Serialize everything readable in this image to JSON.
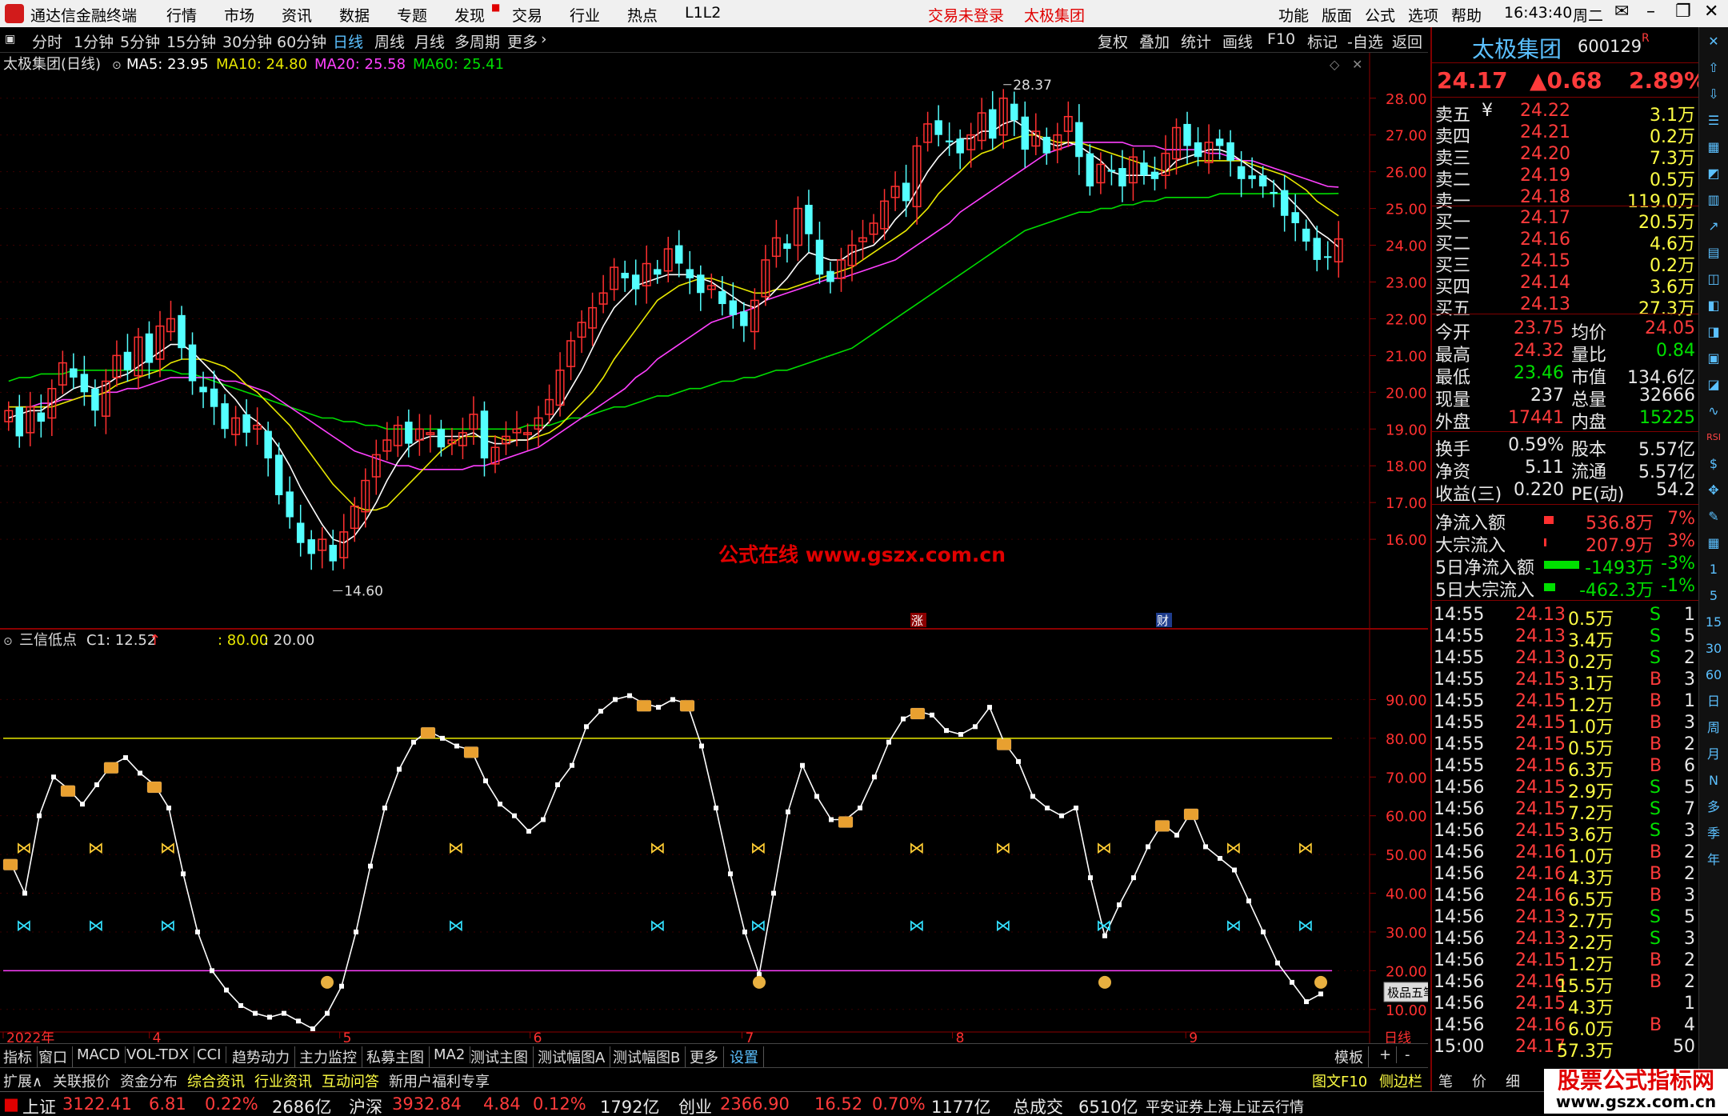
{
  "window": {
    "app_title": "通达信金融终端",
    "menu": [
      "行情",
      "市场",
      "资讯",
      "数据",
      "专题",
      "发现",
      "交易",
      "行业",
      "热点",
      "L1L2"
    ],
    "login_status": "交易未登录",
    "stock_name_title": "太极集团",
    "right_menu": [
      "功能",
      "版面",
      "公式",
      "选项",
      "帮助"
    ],
    "time": "16:43:40",
    "weekday": "周二"
  },
  "toolbar": {
    "periods": [
      "分时",
      "1分钟",
      "5分钟",
      "15分钟",
      "30分钟",
      "60分钟",
      "日线",
      "周线",
      "月线",
      "多周期",
      "更多"
    ],
    "active_period": "日线",
    "actions": [
      "复权",
      "叠加",
      "统计",
      "画线",
      "F10",
      "标记",
      "-自选",
      "返回"
    ]
  },
  "main_chart": {
    "label": "太极集团(日线)",
    "ma5": "MA5: 23.95",
    "ma10": "MA10: 24.80",
    "ma20": "MA20: 25.58",
    "ma60": "MA60: 25.41",
    "high_label": "28.37",
    "low_label": "14.60",
    "watermark": "公式在线   www.gszx.com.cn",
    "marker_zhang": "涨",
    "marker_cai": "财",
    "colors": {
      "up": "#ff3030",
      "down": "#54ffff",
      "ma5": "#ffffff",
      "ma10": "#e8e800",
      "ma20": "#ff40ff",
      "ma60": "#00dd00"
    }
  },
  "chart_data": [
    {
      "type": "candlestick",
      "title": "太极集团(日线)",
      "ylim": [
        14.0,
        28.8
      ],
      "yticks": [
        "28.00",
        "27.00",
        "26.00",
        "25.00",
        "24.00",
        "23.00",
        "22.00",
        "21.00",
        "20.00",
        "19.00",
        "18.00",
        "17.00",
        "16.00"
      ],
      "x_labels": [
        "2022年",
        "4",
        "5",
        "6",
        "7",
        "8",
        "9",
        "日线"
      ],
      "close": [
        19.5,
        18.8,
        19.6,
        19.2,
        20.1,
        20.8,
        20.4,
        20.0,
        19.5,
        20.3,
        21.0,
        20.6,
        21.5,
        20.8,
        21.8,
        22.0,
        21.2,
        20.3,
        20.0,
        19.6,
        19.0,
        19.3,
        18.9,
        19.1,
        18.2,
        17.2,
        16.6,
        15.9,
        15.6,
        16.0,
        15.4,
        16.2,
        16.9,
        17.6,
        18.3,
        18.7,
        19.1,
        18.6,
        19.0,
        18.9,
        18.5,
        18.7,
        18.9,
        19.4,
        18.2,
        18.5,
        18.8,
        19.0,
        18.9,
        19.3,
        19.8,
        20.6,
        21.4,
        21.9,
        22.3,
        22.7,
        23.4,
        23.1,
        22.8,
        23.5,
        23.2,
        23.9,
        23.5,
        23.1,
        22.7,
        22.9,
        22.4,
        22.1,
        21.8,
        22.5,
        23.6,
        24.2,
        23.9,
        25.0,
        24.3,
        23.2,
        23.0,
        23.6,
        24.0,
        24.2,
        24.6,
        25.2,
        25.6,
        25.2,
        26.7,
        27.3,
        27.0,
        26.8,
        26.5,
        27.0,
        27.6,
        26.9,
        28.0,
        27.4,
        26.6,
        27.1,
        26.5,
        27.0,
        27.5,
        26.4,
        25.6,
        26.2,
        26.0,
        25.6,
        26.4,
        25.9,
        25.8,
        26.5,
        27.2,
        26.7,
        26.4,
        26.8,
        26.7,
        26.3,
        25.8,
        25.8,
        25.6,
        25.4,
        24.8,
        24.6,
        24.1,
        23.6,
        23.7,
        24.17
      ],
      "ma5": [
        19.3,
        19.4,
        19.5,
        19.5,
        19.7,
        19.9,
        20.1,
        20.2,
        20.1,
        20.2,
        20.4,
        20.5,
        20.7,
        20.9,
        21.1,
        21.3,
        21.3,
        21.1,
        20.8,
        20.5,
        20.1,
        19.8,
        19.4,
        19.2,
        18.9,
        18.5,
        18.0,
        17.4,
        16.9,
        16.4,
        16.0,
        15.9,
        16.1,
        16.5,
        17.0,
        17.6,
        18.1,
        18.5,
        18.7,
        18.8,
        18.8,
        18.8,
        18.8,
        18.9,
        18.7,
        18.6,
        18.6,
        18.7,
        18.7,
        18.9,
        19.2,
        19.6,
        20.1,
        20.6,
        21.2,
        21.8,
        22.3,
        22.6,
        22.9,
        23.0,
        23.1,
        23.2,
        23.2,
        23.2,
        23.1,
        23.0,
        22.8,
        22.6,
        22.4,
        22.3,
        22.5,
        22.8,
        23.1,
        23.5,
        23.8,
        23.7,
        23.6,
        23.6,
        23.8,
        23.9,
        24.0,
        24.3,
        24.7,
        25.0,
        25.5,
        26.0,
        26.4,
        26.7,
        26.9,
        26.9,
        27.1,
        27.1,
        27.3,
        27.4,
        27.2,
        27.0,
        26.8,
        26.7,
        26.8,
        26.7,
        26.5,
        26.3,
        26.0,
        25.9,
        25.9,
        25.9,
        25.9,
        26.0,
        26.3,
        26.4,
        26.5,
        26.6,
        26.6,
        26.5,
        26.3,
        26.1,
        25.9,
        25.7,
        25.4,
        25.1,
        24.8,
        24.4,
        24.2,
        23.95
      ],
      "ma10": [
        19.6,
        19.6,
        19.6,
        19.6,
        19.6,
        19.7,
        19.8,
        19.9,
        19.9,
        20.0,
        20.2,
        20.3,
        20.4,
        20.5,
        20.6,
        20.8,
        20.9,
        20.9,
        20.9,
        20.8,
        20.7,
        20.5,
        20.2,
        20.0,
        19.7,
        19.4,
        19.1,
        18.7,
        18.3,
        17.9,
        17.5,
        17.2,
        16.9,
        16.8,
        16.8,
        16.9,
        17.2,
        17.5,
        17.8,
        18.1,
        18.4,
        18.6,
        18.8,
        18.8,
        18.8,
        18.8,
        18.7,
        18.7,
        18.7,
        18.8,
        18.9,
        19.1,
        19.4,
        19.7,
        20.0,
        20.4,
        20.9,
        21.3,
        21.7,
        22.1,
        22.5,
        22.7,
        22.9,
        23.0,
        23.1,
        23.1,
        23.0,
        22.9,
        22.8,
        22.7,
        22.7,
        22.8,
        22.8,
        22.9,
        23.0,
        23.1,
        23.2,
        23.3,
        23.4,
        23.6,
        23.8,
        24.0,
        24.2,
        24.4,
        24.7,
        25.0,
        25.4,
        25.7,
        26.0,
        26.3,
        26.5,
        26.6,
        26.8,
        26.9,
        27.0,
        27.0,
        26.9,
        26.8,
        26.8,
        26.8,
        26.7,
        26.6,
        26.5,
        26.4,
        26.3,
        26.2,
        26.1,
        26.0,
        26.1,
        26.2,
        26.3,
        26.3,
        26.3,
        26.3,
        26.3,
        26.2,
        26.1,
        26.0,
        25.9,
        25.7,
        25.5,
        25.2,
        25.0,
        24.8
      ],
      "ma20": [
        19.6,
        19.6,
        19.6,
        19.7,
        19.7,
        19.8,
        19.8,
        19.9,
        19.9,
        20.0,
        20.0,
        20.1,
        20.1,
        20.2,
        20.3,
        20.4,
        20.4,
        20.4,
        20.4,
        20.4,
        20.3,
        20.3,
        20.2,
        20.1,
        20.0,
        19.8,
        19.6,
        19.4,
        19.2,
        19.0,
        18.8,
        18.6,
        18.4,
        18.3,
        18.2,
        18.1,
        18.0,
        18.0,
        17.9,
        17.9,
        17.9,
        17.9,
        17.9,
        18.0,
        18.0,
        18.1,
        18.2,
        18.3,
        18.4,
        18.5,
        18.7,
        18.9,
        19.1,
        19.3,
        19.5,
        19.7,
        19.9,
        20.1,
        20.4,
        20.6,
        20.9,
        21.1,
        21.3,
        21.5,
        21.7,
        21.9,
        22.0,
        22.1,
        22.2,
        22.3,
        22.5,
        22.6,
        22.7,
        22.8,
        22.9,
        23.0,
        23.1,
        23.1,
        23.2,
        23.3,
        23.4,
        23.5,
        23.6,
        23.8,
        24.0,
        24.2,
        24.4,
        24.6,
        24.9,
        25.1,
        25.3,
        25.5,
        25.7,
        25.9,
        26.1,
        26.3,
        26.5,
        26.6,
        26.7,
        26.8,
        26.8,
        26.8,
        26.8,
        26.8,
        26.7,
        26.7,
        26.7,
        26.6,
        26.6,
        26.6,
        26.6,
        26.5,
        26.5,
        26.4,
        26.3,
        26.3,
        26.2,
        26.1,
        26.0,
        25.9,
        25.8,
        25.7,
        25.6,
        25.58
      ],
      "ma60": [
        20.3,
        20.4,
        20.4,
        20.5,
        20.5,
        20.5,
        20.6,
        20.6,
        20.6,
        20.6,
        20.6,
        20.6,
        20.6,
        20.6,
        20.6,
        20.6,
        20.5,
        20.5,
        20.4,
        20.3,
        20.2,
        20.1,
        20.0,
        19.9,
        19.8,
        19.7,
        19.6,
        19.5,
        19.4,
        19.3,
        19.3,
        19.2,
        19.2,
        19.1,
        19.1,
        19.0,
        19.0,
        19.0,
        19.0,
        19.0,
        19.0,
        19.0,
        19.0,
        19.0,
        19.0,
        19.0,
        19.0,
        19.0,
        19.1,
        19.1,
        19.1,
        19.2,
        19.3,
        19.3,
        19.4,
        19.5,
        19.6,
        19.6,
        19.7,
        19.8,
        19.9,
        19.9,
        20.0,
        20.1,
        20.1,
        20.2,
        20.3,
        20.3,
        20.4,
        20.4,
        20.5,
        20.6,
        20.6,
        20.7,
        20.8,
        20.9,
        21.0,
        21.1,
        21.2,
        21.4,
        21.6,
        21.8,
        22.0,
        22.2,
        22.4,
        22.6,
        22.8,
        23.0,
        23.2,
        23.4,
        23.6,
        23.8,
        24.0,
        24.2,
        24.4,
        24.5,
        24.6,
        24.7,
        24.8,
        24.9,
        24.9,
        25.0,
        25.0,
        25.1,
        25.1,
        25.2,
        25.2,
        25.3,
        25.3,
        25.3,
        25.3,
        25.3,
        25.4,
        25.4,
        25.4,
        25.4,
        25.4,
        25.4,
        25.4,
        25.4,
        25.4,
        25.4,
        25.4,
        25.41
      ]
    },
    {
      "type": "line",
      "title": "三信低点",
      "ylim": [
        5,
        100
      ],
      "yticks": [
        "90.00",
        "80.00",
        "70.00",
        "60.00",
        "50.00",
        "40.00",
        "30.00",
        "20.00",
        "10.00"
      ],
      "hlines": [
        80,
        20
      ],
      "values": [
        48,
        40,
        60,
        70,
        67,
        63,
        68,
        73,
        75,
        71,
        68,
        62,
        45,
        30,
        20,
        15,
        11,
        9,
        8,
        9,
        7,
        5,
        9,
        16,
        30,
        47,
        62,
        72,
        79,
        82,
        80,
        78,
        77,
        69,
        63,
        60,
        56,
        59,
        68,
        73,
        83,
        87,
        90,
        91,
        89,
        88,
        90,
        89,
        78,
        62,
        45,
        30,
        19,
        40,
        61,
        73,
        65,
        59,
        59,
        62,
        70,
        79,
        85,
        87,
        86,
        82,
        81,
        83,
        88,
        79,
        74,
        65,
        62,
        60,
        62,
        44,
        29,
        37,
        44,
        52,
        58,
        55,
        61,
        52,
        49,
        46,
        38,
        30,
        22,
        17,
        12,
        14
      ]
    }
  ],
  "indicator": {
    "label": "三信低点",
    "c1": "C1: 12.52",
    "param1": ": 80.00",
    "param2": ": 20.00"
  },
  "quote_panel": {
    "name": "太极集团",
    "code": "600129",
    "code_flag": "R",
    "price": "24.17",
    "change": "▲0.68",
    "change_pct": "2.89%",
    "asks": [
      {
        "label": "卖五",
        "extra": "¥",
        "price": "24.22",
        "vol": "3.1万"
      },
      {
        "label": "卖四",
        "extra": "",
        "price": "24.21",
        "vol": "0.2万"
      },
      {
        "label": "卖三",
        "extra": "",
        "price": "24.20",
        "vol": "7.3万"
      },
      {
        "label": "卖二",
        "extra": "",
        "price": "24.19",
        "vol": "0.5万"
      },
      {
        "label": "卖一",
        "extra": "",
        "price": "24.18",
        "vol": "119.0万"
      }
    ],
    "bids": [
      {
        "label": "买一",
        "price": "24.17",
        "vol": "20.5万"
      },
      {
        "label": "买二",
        "price": "24.16",
        "vol": "4.6万"
      },
      {
        "label": "买三",
        "price": "24.15",
        "vol": "0.2万"
      },
      {
        "label": "买四",
        "price": "24.14",
        "vol": "3.6万"
      },
      {
        "label": "买五",
        "price": "24.13",
        "vol": "27.3万"
      }
    ],
    "stats": [
      {
        "l1": "今开",
        "v1": "23.75",
        "c1": "red",
        "l2": "均价",
        "v2": "24.05",
        "c2": "red"
      },
      {
        "l1": "最高",
        "v1": "24.32",
        "c1": "red",
        "l2": "量比",
        "v2": "0.84",
        "c2": "green"
      },
      {
        "l1": "最低",
        "v1": "23.46",
        "c1": "green",
        "l2": "市值",
        "v2": "134.6亿",
        "c2": "white"
      },
      {
        "l1": "现量",
        "v1": "237",
        "c1": "white",
        "l2": "总量",
        "v2": "32666",
        "c2": "white"
      },
      {
        "l1": "外盘",
        "v1": "17441",
        "c1": "red",
        "l2": "内盘",
        "v2": "15225",
        "c2": "green"
      }
    ],
    "stats2": [
      {
        "l1": "换手",
        "v1": "0.59%",
        "l2": "股本",
        "v2": "5.57亿"
      },
      {
        "l1": "净资",
        "v1": "5.11",
        "l2": "流通",
        "v2": "5.57亿"
      },
      {
        "l1": "收益(三)",
        "v1": "0.220",
        "l2": "PE(动)",
        "v2": "54.2"
      }
    ],
    "flows": [
      {
        "label": "净流入额",
        "bar": 0.15,
        "color": "red",
        "value": "536.8万",
        "pct": "7%"
      },
      {
        "label": "大宗流入",
        "bar": 0.04,
        "color": "red",
        "value": "207.9万",
        "pct": "3%"
      },
      {
        "label": "5日净流入额",
        "bar": 0.55,
        "color": "green",
        "value": "-1493万",
        "pct": "-3%"
      },
      {
        "label": "5日大宗流入",
        "bar": 0.18,
        "color": "green",
        "value": "-462.3万",
        "pct": "-1%"
      }
    ],
    "ticks": [
      {
        "t": "14:55",
        "p": "24.13",
        "pc": "red",
        "v": "0.5万",
        "s": "S",
        "n": "1"
      },
      {
        "t": "14:55",
        "p": "24.13",
        "pc": "red",
        "v": "3.4万",
        "s": "S",
        "n": "5"
      },
      {
        "t": "14:55",
        "p": "24.13",
        "pc": "red",
        "v": "0.2万",
        "s": "S",
        "n": "2"
      },
      {
        "t": "14:55",
        "p": "24.15",
        "pc": "red",
        "v": "3.1万",
        "s": "B",
        "n": "3"
      },
      {
        "t": "14:55",
        "p": "24.15",
        "pc": "red",
        "v": "1.2万",
        "s": "B",
        "n": "1"
      },
      {
        "t": "14:55",
        "p": "24.15",
        "pc": "red",
        "v": "1.0万",
        "s": "B",
        "n": "3"
      },
      {
        "t": "14:55",
        "p": "24.15",
        "pc": "red",
        "v": "0.5万",
        "s": "B",
        "n": "2"
      },
      {
        "t": "14:55",
        "p": "24.15",
        "pc": "red",
        "v": "6.3万",
        "s": "B",
        "n": "6"
      },
      {
        "t": "14:56",
        "p": "24.15",
        "pc": "red",
        "v": "2.9万",
        "s": "S",
        "n": "5"
      },
      {
        "t": "14:56",
        "p": "24.15",
        "pc": "red",
        "v": "7.2万",
        "s": "S",
        "n": "7"
      },
      {
        "t": "14:56",
        "p": "24.15",
        "pc": "red",
        "v": "3.6万",
        "s": "S",
        "n": "3"
      },
      {
        "t": "14:56",
        "p": "24.16",
        "pc": "red",
        "v": "1.0万",
        "s": "B",
        "n": "2"
      },
      {
        "t": "14:56",
        "p": "24.16",
        "pc": "red",
        "v": "4.3万",
        "s": "B",
        "n": "2"
      },
      {
        "t": "14:56",
        "p": "24.16",
        "pc": "red",
        "v": "6.5万",
        "s": "B",
        "n": "3"
      },
      {
        "t": "14:56",
        "p": "24.13",
        "pc": "red",
        "v": "2.7万",
        "s": "S",
        "n": "5"
      },
      {
        "t": "14:56",
        "p": "24.13",
        "pc": "red",
        "v": "2.2万",
        "s": "S",
        "n": "3"
      },
      {
        "t": "14:56",
        "p": "24.15",
        "pc": "red",
        "v": "1.2万",
        "s": "B",
        "n": "2"
      },
      {
        "t": "14:56",
        "p": "24.16",
        "pc": "red",
        "v": "15.5万",
        "s": "B",
        "n": "2"
      },
      {
        "t": "14:56",
        "p": "24.15",
        "pc": "red",
        "v": "4.3万",
        "s": "",
        "n": "1"
      },
      {
        "t": "14:56",
        "p": "24.16",
        "pc": "red",
        "v": "6.0万",
        "s": "B",
        "n": "4"
      },
      {
        "t": "15:00",
        "p": "24.17",
        "pc": "red",
        "v": "57.3万",
        "s": "",
        "n": "50"
      }
    ]
  },
  "ime_popup": "极品五笔",
  "tabs1": [
    "指标",
    "窗口",
    "MACD",
    "VOL-TDX",
    "CCI",
    "趋势动力",
    "主力监控",
    "私募主图",
    "MA2",
    "测试主图",
    "测试幅图A",
    "测试幅图B",
    "更多",
    "设置"
  ],
  "tabs1_right": [
    "模板",
    "+",
    "-"
  ],
  "tabs2": [
    "扩展∧",
    "关联报价",
    "资金分布",
    "综合资讯",
    "行业资讯",
    "互动问答",
    "新用户福利专享"
  ],
  "tabs2_right": [
    "图文F10",
    "侧边栏《",
    "笔",
    "价",
    "细"
  ],
  "status": {
    "sh_label": "上证",
    "sh_val": "3122.41",
    "sh_chg": "6.81",
    "sh_pct": "0.22%",
    "sh_amt": "2686亿",
    "sz_label": "沪深",
    "sz_val": "3932.84",
    "sz_chg": "4.84",
    "sz_pct": "0.12%",
    "sz_amt": "1792亿",
    "cy_label": "创业",
    "cy_val": "2366.90",
    "cy_chg": "16.52",
    "cy_pct": "0.70%",
    "cy_amt": "1177亿",
    "total_label": "总成交",
    "total_val": "6510亿",
    "source": "平安证券上海上证云行情"
  },
  "corner_logo": {
    "title": "股票公式指标网",
    "url": "www.gszx.com.cn"
  },
  "right_icons": [
    "x",
    "up-icon",
    "down-icon",
    "list-icon",
    "grid-icon",
    "chart-icon",
    "bars-icon",
    "trend-icon",
    "f10-icon",
    "l2-icon",
    "sector-icon",
    "f2-icon",
    "fund-icon",
    "compare-icon",
    "wave-icon",
    "RSI",
    "money-icon",
    "move-icon",
    "draw-icon",
    "table-icon",
    "1",
    "5",
    "15",
    "30",
    "60",
    "日",
    "周",
    "月",
    "N",
    "多",
    "季",
    "年"
  ]
}
